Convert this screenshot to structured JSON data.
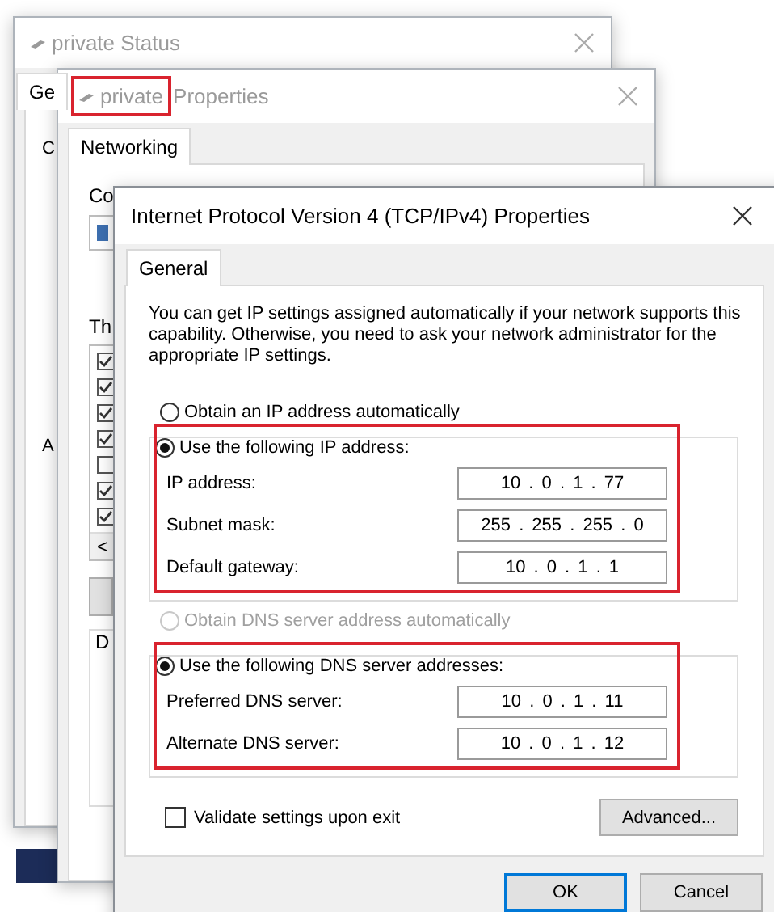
{
  "status_window": {
    "title": "private Status",
    "tabs": [
      {
        "label": "Ge",
        "selected": true
      }
    ],
    "labels": [
      "C",
      "A"
    ]
  },
  "properties_window": {
    "network_name": "private",
    "name_highlighted": true,
    "title": "Properties",
    "tabs": [
      {
        "label": "Networking",
        "selected": true
      }
    ],
    "connect_label": "Co",
    "components_label": "Th",
    "components": [
      {
        "checked": true
      },
      {
        "checked": true
      },
      {
        "checked": true
      },
      {
        "checked": true
      },
      {
        "checked": false
      },
      {
        "checked": true
      },
      {
        "checked": true
      }
    ],
    "scroll_arrow": "<",
    "description_label": "D"
  },
  "ipv4_window": {
    "title": "Internet Protocol Version 4 (TCP/IPv4) Properties",
    "tabs": [
      {
        "label": "General",
        "selected": true
      }
    ],
    "description": "You can get IP settings assigned automatically if your network supports this capability. Otherwise, you need to ask your network administrator for the appropriate IP settings.",
    "ip_auto": {
      "label": "Obtain an IP address automatically",
      "selected": false,
      "disabled": false
    },
    "ip_section": {
      "label": "Use the following IP address:",
      "selected": true,
      "disabled": false,
      "highlighted": true,
      "fields": [
        {
          "label": "IP address:",
          "value": "10 . 0 . 1 . 77"
        },
        {
          "label": "Subnet mask:",
          "value": "255 . 255 . 255 . 0"
        },
        {
          "label": "Default gateway:",
          "value": "10 . 0 . 1 . 1"
        }
      ]
    },
    "dns_auto": {
      "label": "Obtain DNS server address automatically",
      "selected": false,
      "disabled": true
    },
    "dns_section": {
      "label": "Use the following DNS server addresses:",
      "selected": true,
      "disabled": false,
      "highlighted": true,
      "fields": [
        {
          "label": "Preferred DNS server:",
          "value": "10 . 0 . 1 . 11"
        },
        {
          "label": "Alternate DNS server:",
          "value": "10 . 0 . 1 . 12"
        }
      ]
    },
    "validate": {
      "label": "Validate settings upon exit",
      "checked": false
    },
    "advanced_button": "Advanced...",
    "buttons": [
      {
        "label": "OK",
        "default": true
      },
      {
        "label": "Cancel",
        "default": false
      }
    ]
  }
}
